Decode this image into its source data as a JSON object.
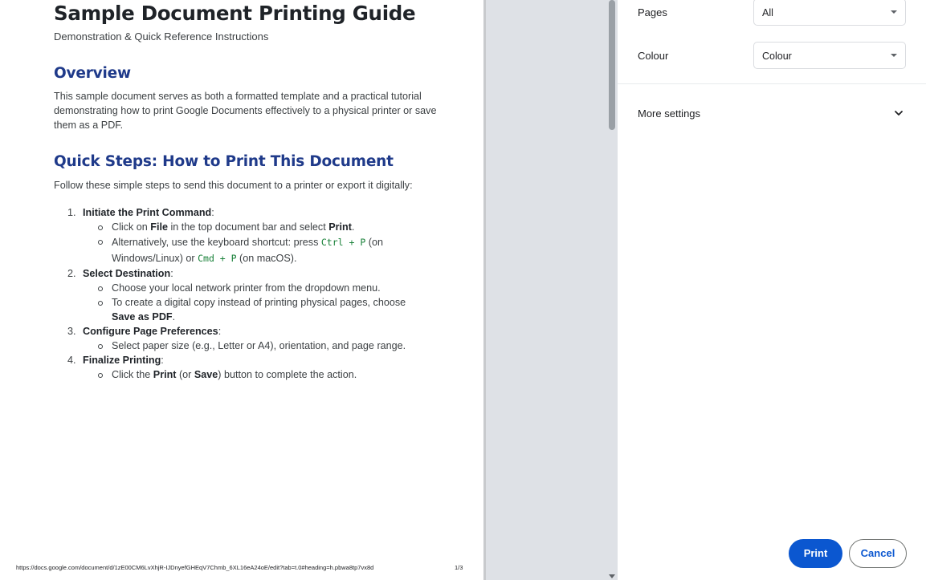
{
  "document": {
    "title": "Sample Document Printing Guide",
    "subtitle": "Demonstration & Quick Reference Instructions",
    "overview_heading": "Overview",
    "overview_text": "This sample document serves as both a formatted template and a practical tutorial demonstrating how to print Google Documents effectively to a physical printer or save them as a PDF.",
    "quick_heading": "Quick Steps: How to Print This Document",
    "quick_intro": "Follow these simple steps to send this document to a printer or export it digitally:",
    "steps": [
      {
        "num": "1.",
        "title": "Initiate the Print Command",
        "items": [
          {
            "pre": "Click on ",
            "b1": "File",
            "mid": " in the top document bar and select ",
            "b2": "Print",
            "post": "."
          },
          {
            "pre": "Alternatively, use the keyboard shortcut: press ",
            "kbd1": "Ctrl + P",
            "mid": " (on Windows/Linux) or ",
            "kbd2": "Cmd + P",
            "post": " (on macOS)."
          }
        ]
      },
      {
        "num": "2.",
        "title": "Select Destination",
        "items": [
          {
            "text": "Choose your local network printer from the dropdown menu."
          },
          {
            "pre": "To create a digital copy instead of printing physical pages, choose ",
            "b1": "Save as PDF",
            "post": "."
          }
        ]
      },
      {
        "num": "3.",
        "title": "Configure Page Preferences",
        "items": [
          {
            "text": "Select paper size (e.g., Letter or A4), orientation, and page range."
          }
        ]
      },
      {
        "num": "4.",
        "title": "Finalize Printing",
        "items": [
          {
            "pre": "Click the ",
            "b1": "Print",
            "mid": " (or ",
            "b2": "Save",
            "post": ") button to complete the action."
          }
        ]
      }
    ],
    "footer_url": "https://docs.google.com/document/d/1zE00CM6LvXhjR-IJDnyefGHEqV7Chmb_6XL16eA24oE/edit?tab=t.0#heading=h.pbwa8tp7vx8d",
    "footer_page": "1/3"
  },
  "settings": {
    "pages": {
      "label": "Pages",
      "value": "All"
    },
    "colour": {
      "label": "Colour",
      "value": "Colour"
    },
    "more_settings": "More settings",
    "print_button": "Print",
    "cancel_button": "Cancel"
  },
  "colors": {
    "heading_blue": "#1f3a8a",
    "print_button": "#0b57d0",
    "code_green": "#188038"
  },
  "icons": [
    "caret-down-icon",
    "chevron-down-icon"
  ]
}
